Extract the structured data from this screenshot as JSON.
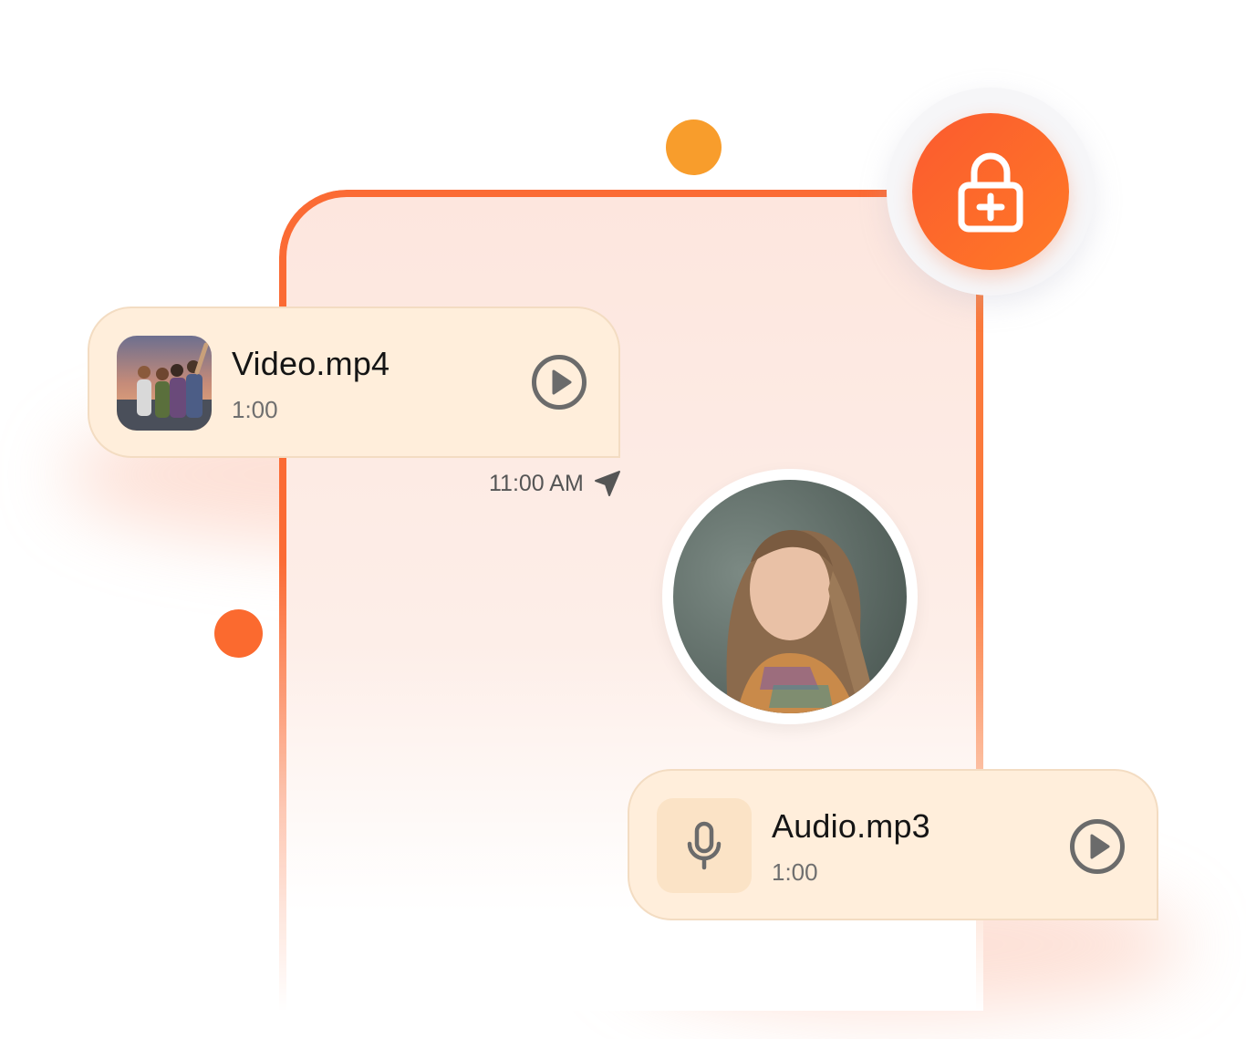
{
  "video_message": {
    "file_name": "Video.mp4",
    "duration": "1:00",
    "thumbnail": "group-selfie-photo"
  },
  "video_timestamp": "11:00 AM",
  "avatar": "woman-portrait-photo",
  "audio_message": {
    "file_name": "Audio.mp3",
    "duration": "1:00"
  },
  "icons": {
    "lock": "lock-plus-icon",
    "play": "play-circle-icon",
    "mic": "microphone-icon",
    "sent": "send-arrow-icon"
  },
  "colors": {
    "accent": "#fb6b34",
    "accent_orange": "#f89d2c",
    "bubble_bg": "#ffeedb",
    "text": "#151515",
    "muted": "#6f6f6f"
  }
}
